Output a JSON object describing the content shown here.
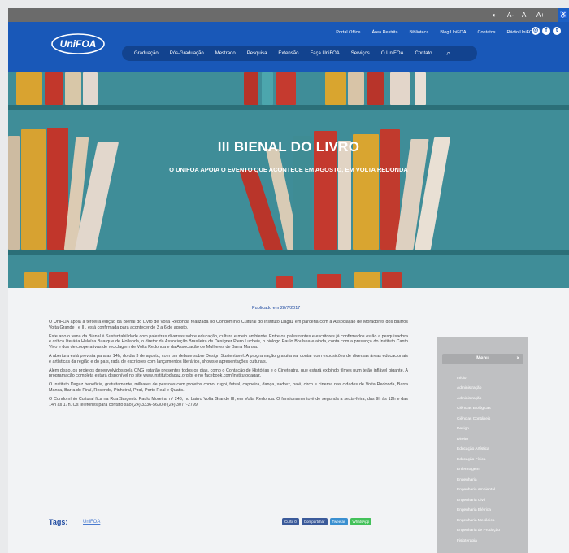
{
  "utility_bar": {
    "contrast_icon": "◐",
    "font_small": "A-",
    "font_normal": "A",
    "font_large": "A+",
    "a11y_icon": "♿"
  },
  "header": {
    "logo_text": "UniFOA",
    "top_links": [
      "Portal Office",
      "Área Restrita",
      "Biblioteca",
      "Blog UniFOA",
      "Contatos",
      "Rádio UniFOA"
    ],
    "social": [
      "instagram-icon",
      "facebook-icon",
      "twitter-icon"
    ],
    "social_glyphs": [
      "◎",
      "f",
      "t"
    ],
    "nav": [
      "Graduação",
      "Pós-Graduação",
      "Mestrado",
      "Pesquisa",
      "Extensão",
      "Faça UniFOA",
      "Serviços",
      "O UniFOA",
      "Contato"
    ],
    "search_glyph": "⌕"
  },
  "hero": {
    "title": "III BIENAL DO LIVRO",
    "subtitle": "O UNIFOA APOIA O EVENTO QUE ACONTECE EM AGOSTO, EM VOLTA REDONDA"
  },
  "article": {
    "published": "Publicado em 28/7/2017",
    "paragraphs": [
      "O UniFOA apoia a terceira edição da Bienal do Livro de Volta Redonda realizada no Condomínio Cultural do Instituto Dagaz em parceria com a Associação de Moradores dos Bairros Volta Grande I e III, está confirmada para acontecer de 3 a 6 de agosto.",
      "Este ano o tema da Bienal é Sustentabilidade com palestras diversas sobre educação, cultura e meio ambiente. Entre os palestrantes e escritores já confirmados estão a pesquisadora e crítica literária Heloísa Buarque de Hollanda, o diretor da Associação Brasileira de Designer Piero Lucheis, o biólogo Paulo Boulsea e ainda, conta com a presença do Instituto Canto Vivo e dos de cooperativas de reciclagem de Volta Redonda e da Associação de Mulheres de Barra Mansa.",
      "A abertura está prevista para as 14h, do dia 3 de agosto, com um debate sobre Design Sustentável. A programação gratuita vai contar com exposições de diversas áreas educacionais e artísticas da região e do país, rada de escritores com lançamentos literários, shows e apresentações culturais.",
      "Além disso, os projetos desenvolvidos pela ONG estarão presentes todos os dias, como o Contação de Histórias e o Cineteatra, que estará exibindo filmes num telão inflável gigante. A programação completa estará disponível no site www.institutodagaz.org.br e no facebook.com/institutodagaz.",
      "O Instituto Dagaz beneficia, gratuitamente, milhares de pessoas com projetos como: rugbi, futsal, capoeira, dança, xadrez, balé, circo e cinema nas cidades de Volta Redonda, Barra Mansa, Barra do Piraí, Resende, Pinheiral, Piraí, Porto Real e Quatis.",
      "O Condomínio Cultural fica na Rua Sargento Paulo Moreira, nº 246, no bairro Volta Grande III, em Volta Redonda. O funcionamento é de segunda a sexta-feira, das 9h às 12h e das 14h às 17h. Os telefones para contato são (24) 3336-5630 e (24) 3077-2799."
    ],
    "tags_label": "Tags:",
    "tag": "UniFOA",
    "share_buttons": [
      {
        "label": "Curtir 0",
        "color": "#3b5a9a"
      },
      {
        "label": "Compartilhar",
        "color": "#3b5a9a"
      },
      {
        "label": "Tweetar",
        "color": "#3a8fd0"
      },
      {
        "label": "WhatsApp",
        "color": "#43c15a"
      }
    ]
  },
  "sidebar": {
    "title": "Menu",
    "close_glyph": "×",
    "items": [
      "Início",
      "Administração",
      "Administração",
      "Ciências Biológicas",
      "Ciências Contábeis",
      "Design",
      "Direito",
      "Educação Artística",
      "Educação Física",
      "Enfermagem",
      "Engenharia",
      "Engenharia Ambiental",
      "Engenharia Civil",
      "Engenharia Elétrica",
      "Engenharia Mecânica",
      "Engenharia de Produção",
      "Fisioterapia"
    ]
  }
}
